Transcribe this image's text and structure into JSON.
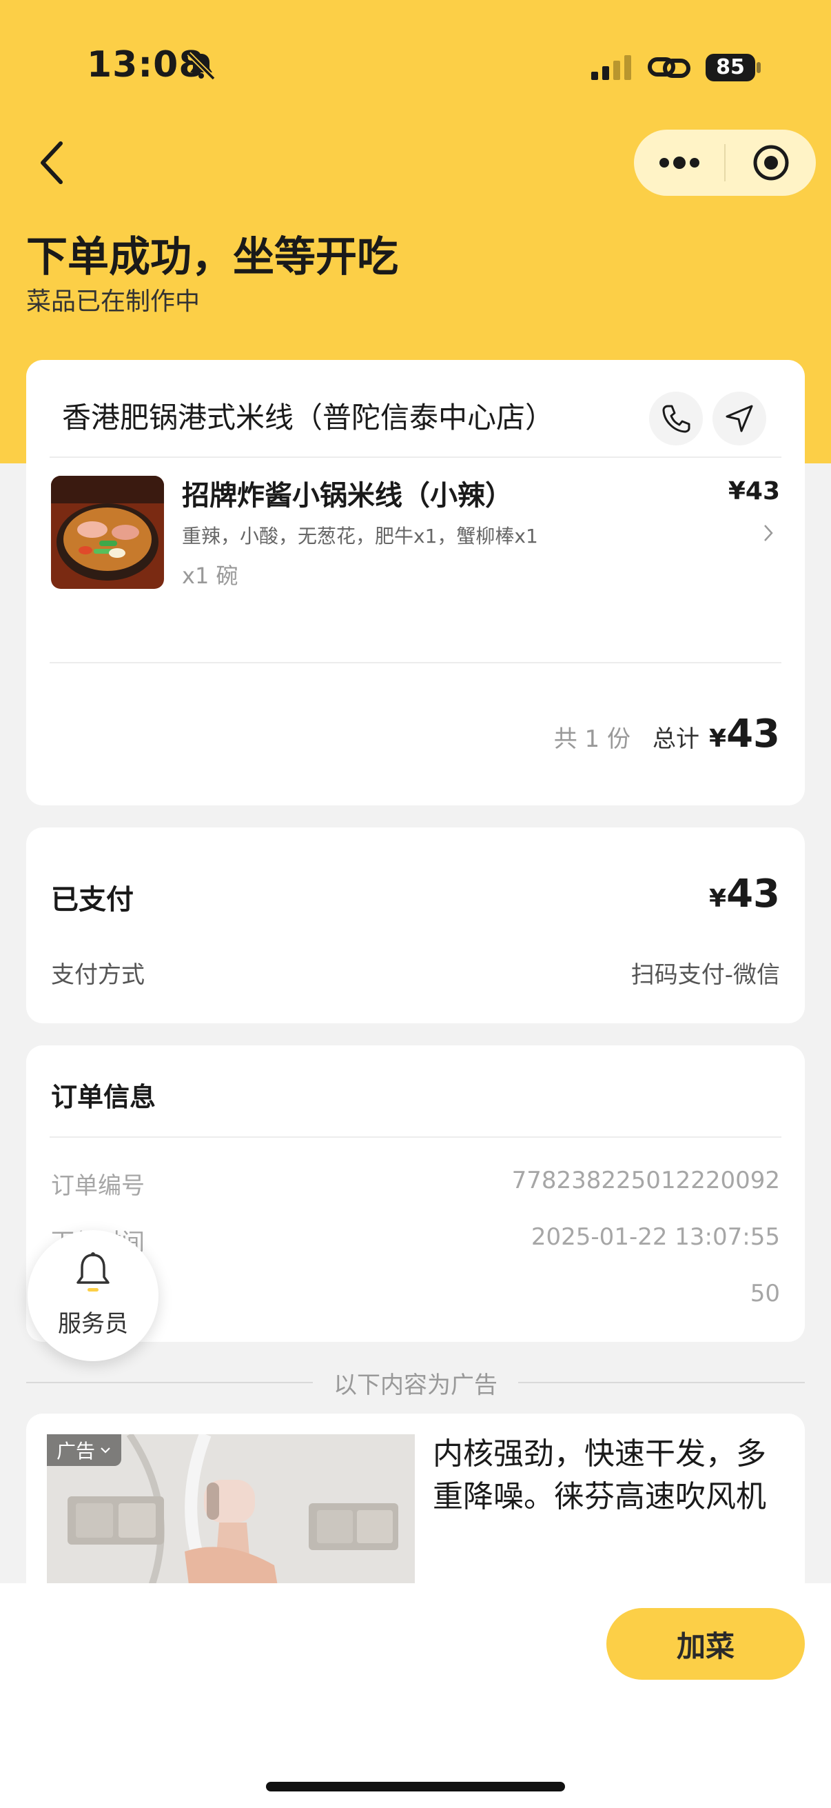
{
  "status_bar": {
    "time": "13:08",
    "battery": "85"
  },
  "header": {
    "title": "下单成功，坐等开吃",
    "subtitle": "菜品已在制作中"
  },
  "order": {
    "store_name": "香港肥锅港式米线（普陀信泰中心店）",
    "item": {
      "name": "招牌炸酱小锅米线（小辣）",
      "spec": "重辣，小酸，无葱花，肥牛x1，蟹柳棒x1",
      "qty": "x1 碗",
      "price": "¥43"
    },
    "total": {
      "count": "共 1 份",
      "label": "总计",
      "currency": "¥",
      "amount": "43"
    }
  },
  "payment": {
    "status": "已支付",
    "currency": "¥",
    "amount": "43",
    "method_label": "支付方式",
    "method_value": "扫码支付-微信"
  },
  "order_info": {
    "title": "订单信息",
    "rows": [
      {
        "label": "订单编号",
        "value": "778238225012220092"
      },
      {
        "label": "下单时间",
        "value": "2025-01-22 13:07:55"
      },
      {
        "label": "",
        "value": "50"
      }
    ]
  },
  "waiter": {
    "label": "服务员"
  },
  "ad": {
    "separator": "以下内容为广告",
    "tag": "广告",
    "text": "内核强劲，快速干发，多重降噪。徕芬高速吹风机"
  },
  "bottom": {
    "add_button": "加菜"
  },
  "colors": {
    "brand_yellow": "#fccf47",
    "capsule_bg": "#fff3c6"
  }
}
